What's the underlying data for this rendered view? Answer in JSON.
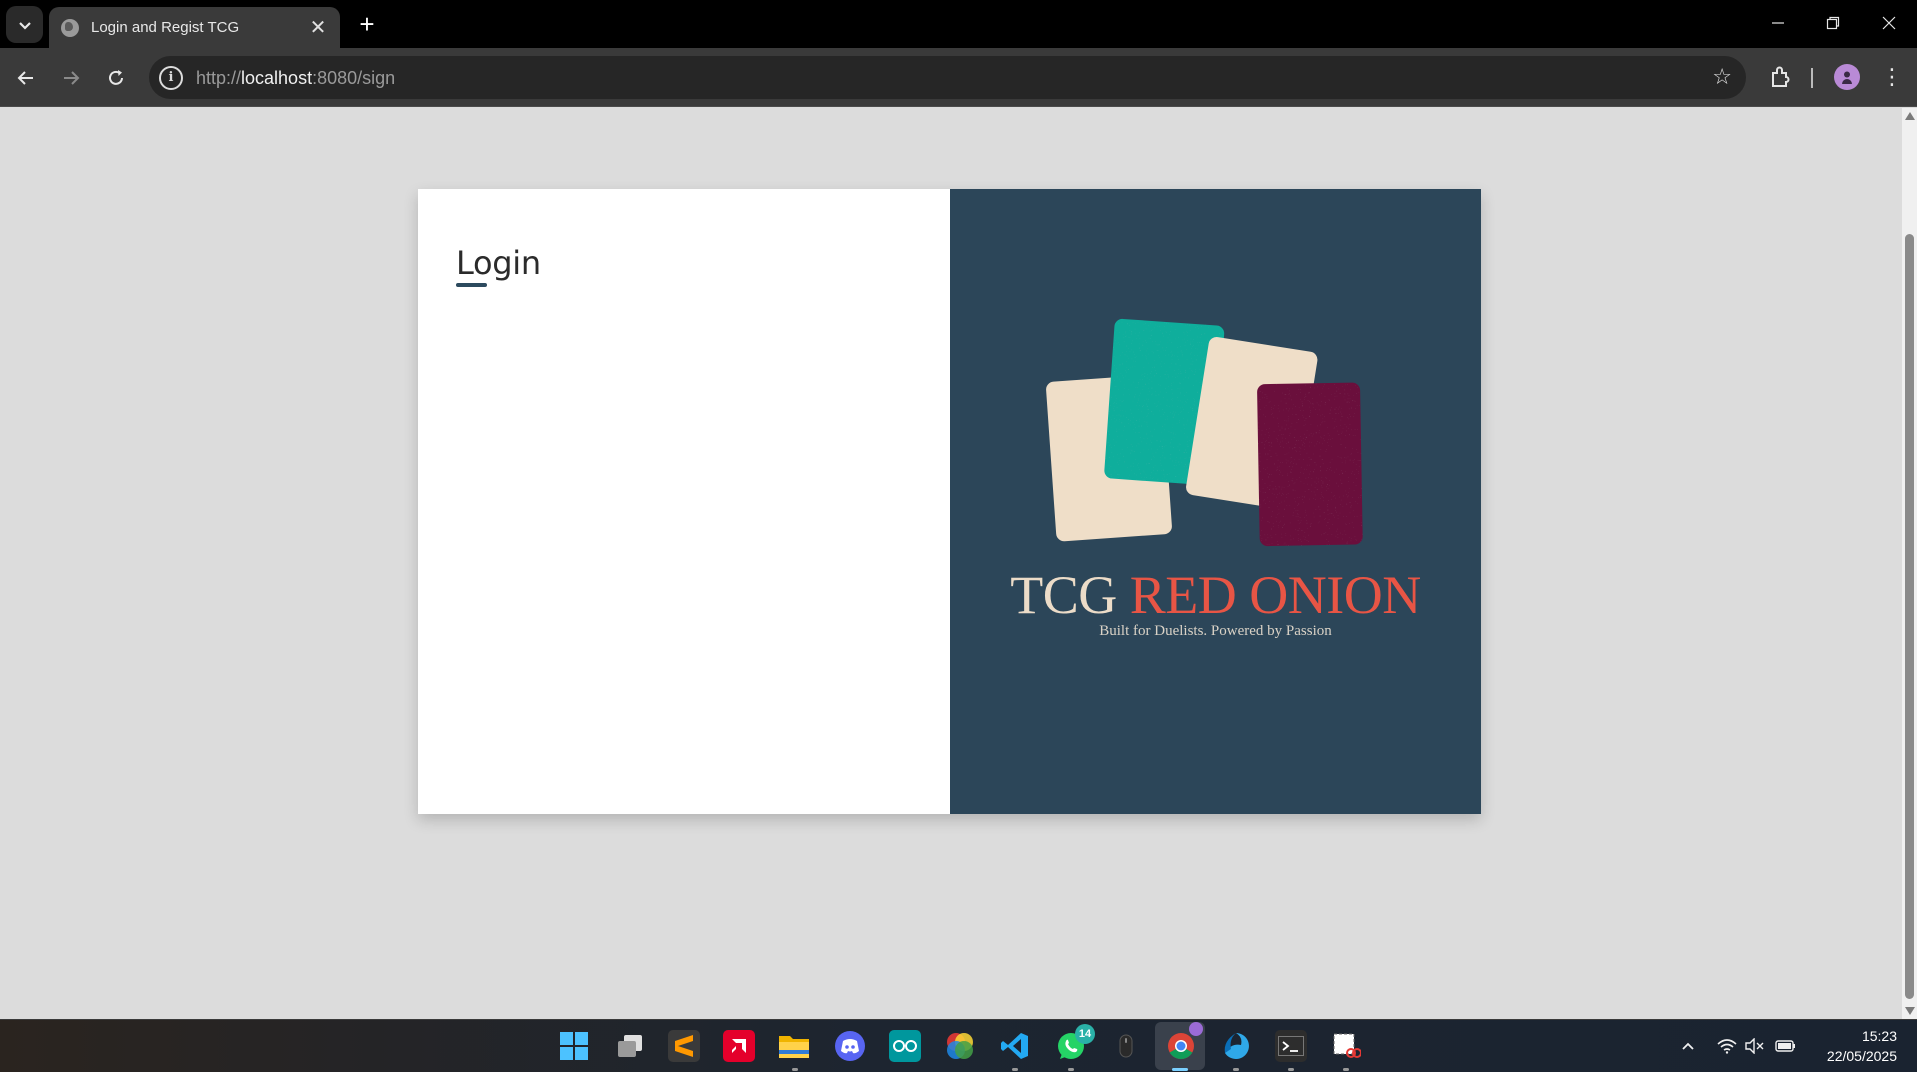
{
  "browser": {
    "tab_title": "Login and Regist TCG",
    "url_scheme": "http://",
    "url_host": "localhost",
    "url_path": ":8080/sign",
    "icons": [
      "tab-list-icon",
      "globe-icon",
      "close-icon",
      "plus-icon",
      "minimize-icon",
      "restore-icon",
      "window-close-icon",
      "back-icon",
      "forward-icon",
      "reload-icon",
      "site-info-icon",
      "bookmark-star-icon",
      "extensions-icon",
      "profile-icon",
      "menu-icon"
    ]
  },
  "page": {
    "login_title": "Login",
    "brand_name_part1": "TCG",
    "brand_name_part2": "RED ONION",
    "brand_tagline": "Built for Duelists. Powered by Passion",
    "colors": {
      "background": "#dcdcdc",
      "brand_panel": "#2c4659",
      "accent_red": "#e85545",
      "card_teal": "#0fae9c",
      "card_cream": "#efdec8",
      "card_maroon": "#6a0f3c",
      "title_underline": "#2c4a5e"
    }
  },
  "taskbar": {
    "apps": [
      "windows-start-icon",
      "task-view-icon",
      "sublime-text-icon",
      "amd-software-icon",
      "file-explorer-icon",
      "discord-icon",
      "arduino-icon",
      "color-wheel-app-icon",
      "vscode-icon",
      "whatsapp-icon",
      "mouse-app-icon",
      "chrome-icon",
      "edge-dev-icon",
      "terminal-icon",
      "snipping-tool-icon"
    ],
    "whatsapp_badge": "14",
    "clock_time": "15:23",
    "clock_date": "22/05/2025",
    "tray_icons": [
      "chevron-up-icon",
      "wifi-icon",
      "volume-muted-icon",
      "battery-icon"
    ]
  }
}
